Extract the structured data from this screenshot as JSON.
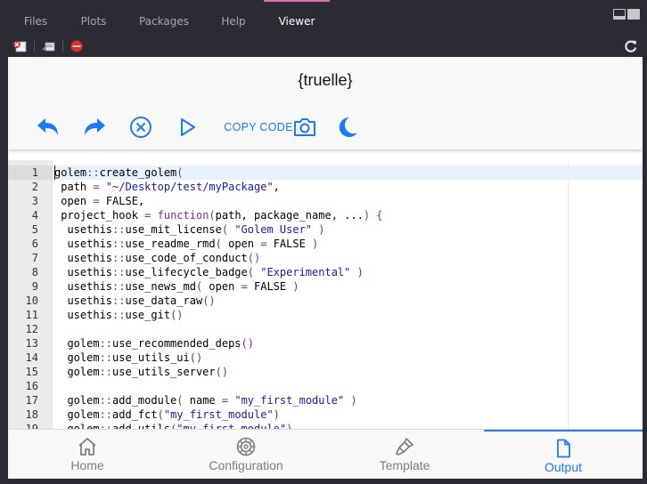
{
  "pane_tabs": [
    {
      "label": "Files",
      "active": false
    },
    {
      "label": "Plots",
      "active": false
    },
    {
      "label": "Packages",
      "active": false
    },
    {
      "label": "Help",
      "active": false
    },
    {
      "label": "Viewer",
      "active": true
    }
  ],
  "toolbar": {
    "icons": [
      "clear-viewer-icon",
      "export-icon",
      "stop-icon",
      "refresh-icon"
    ]
  },
  "app": {
    "title": "{truelle}",
    "copy_code_label": "COPY CODE",
    "accent_color": "#1a7cf0"
  },
  "editor": {
    "active_line": 1,
    "lines": [
      "golem::create_golem(",
      " path = \"~/Desktop/test/myPackage\",",
      " open = FALSE,",
      " project_hook = function(path, package_name, ...) {",
      "  usethis::use_mit_license( \"Golem User\" )",
      "  usethis::use_readme_rmd( open = FALSE )",
      "  usethis::use_code_of_conduct()",
      "  usethis::use_lifecycle_badge( \"Experimental\" )",
      "  usethis::use_news_md( open = FALSE )",
      "  usethis::use_data_raw()",
      "  usethis::use_git()",
      "",
      "  golem::use_recommended_deps()",
      "  golem::use_utils_ui()",
      "  golem::use_utils_server()",
      "",
      "  golem::add_module( name = \"my_first_module\" )",
      "  golem::add_fct(\"my_first_module\")",
      "  golem::add_utils(\"my_first_module\")"
    ]
  },
  "bottom_nav": [
    {
      "label": "Home",
      "icon": "home-icon",
      "active": false
    },
    {
      "label": "Configuration",
      "icon": "gear-icon",
      "active": false
    },
    {
      "label": "Template",
      "icon": "brush-icon",
      "active": false
    },
    {
      "label": "Output",
      "icon": "file-icon",
      "active": true
    }
  ]
}
